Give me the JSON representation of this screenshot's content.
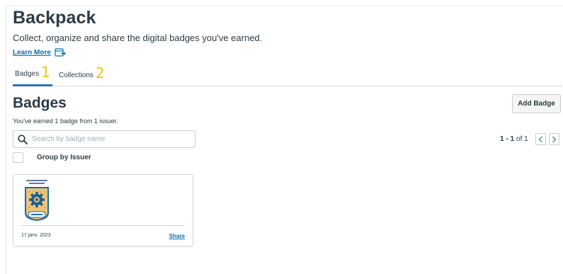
{
  "header": {
    "title": "Backpack",
    "subtitle": "Collect, organize and share the digital badges you've earned.",
    "learn_more": "Learn More"
  },
  "tabs": [
    {
      "label": "Badges",
      "annotation": "1",
      "active": true
    },
    {
      "label": "Collections",
      "annotation": "2",
      "active": false
    }
  ],
  "badges_section": {
    "title": "Badges",
    "earned_text": "You've earned 1 badge from 1 issuer.",
    "add_badge_label": "Add Badge",
    "search": {
      "placeholder": "Search by badge name",
      "value": ""
    },
    "group_by_label": "Group by Issuer",
    "pagination": {
      "range": "1 - 1",
      "of_text": "of 1"
    }
  },
  "badges": [
    {
      "date": "17 janv. 2023",
      "share_label": "Share",
      "icon": "badge-image"
    }
  ],
  "colors": {
    "accent_link": "#0770a3",
    "active_tab": "#2d73b5",
    "annotation": "#f5c10a",
    "text": "#2d3b45"
  }
}
